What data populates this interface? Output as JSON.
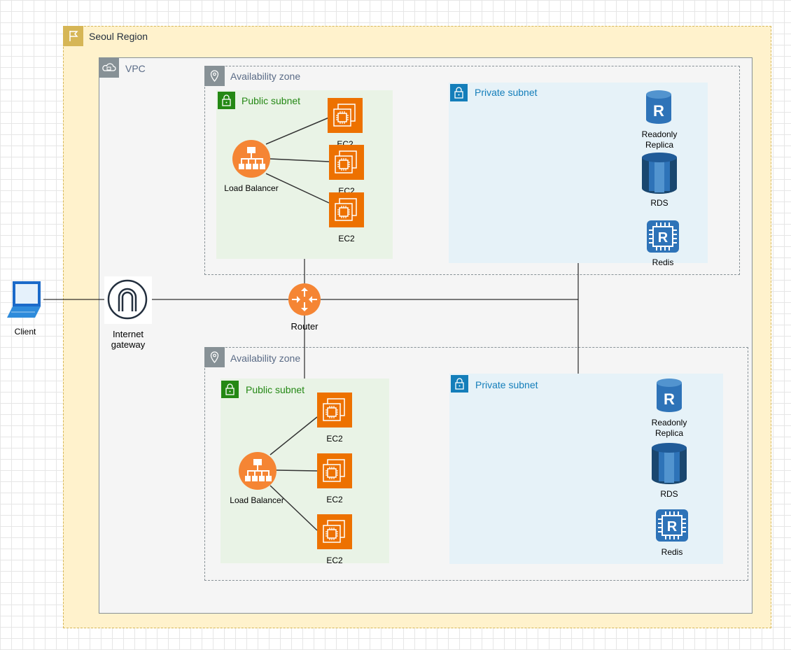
{
  "region": {
    "label": "Seoul Region",
    "icon": "flag-icon"
  },
  "vpc": {
    "label": "VPC",
    "icon": "cloud-lock-icon"
  },
  "availability_zones": [
    {
      "label": "Availability zone",
      "public_subnet": {
        "label": "Public subnet",
        "load_balancer": "Load Balancer",
        "instances": [
          "EC2",
          "EC2",
          "EC2"
        ]
      },
      "private_subnet": {
        "label": "Private subnet",
        "replica": "Readonly\nReplica",
        "rds": "RDS",
        "redis": "Redis"
      }
    },
    {
      "label": "Availability zone",
      "public_subnet": {
        "label": "Public subnet",
        "load_balancer": "Load Balancer",
        "instances": [
          "EC2",
          "EC2",
          "EC2"
        ]
      },
      "private_subnet": {
        "label": "Private subnet",
        "replica": "Readonly\nReplica",
        "rds": "RDS",
        "redis": "Redis"
      }
    }
  ],
  "client": {
    "label": "Client"
  },
  "internet_gateway": {
    "label": "Internet\ngateway"
  },
  "router": {
    "label": "Router"
  },
  "colors": {
    "region_fill": "#FFF2CC",
    "region_border": "#D6B656",
    "vpc_border": "#879196",
    "public_subnet": "#248814",
    "private_subnet": "#147EBA",
    "ec2": "#ED7100",
    "load_balancer": "#F58534",
    "database": "#2E73B8"
  }
}
